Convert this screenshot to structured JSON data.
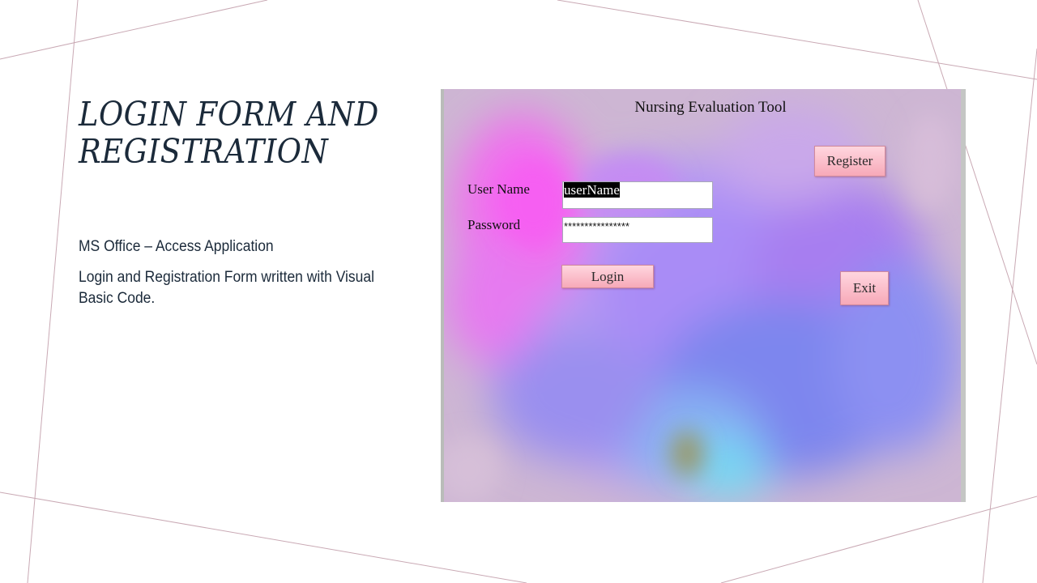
{
  "slide": {
    "title": "LOGIN FORM AND REGISTRATION",
    "bullets": [
      "MS Office – Access Application",
      "Login and Registration Form written with Visual Basic Code."
    ]
  },
  "form": {
    "heading": "Nursing Evaluation Tool",
    "username_label": "User Name",
    "username_value": "userName",
    "password_label": "Password",
    "password_value": "****************",
    "login_label": "Login",
    "register_label": "Register",
    "exit_label": "Exit"
  },
  "colors": {
    "title_text": "#1b2a3a",
    "button_fill": "#f7a9b8",
    "deco_lines": "#c9a9b4"
  }
}
